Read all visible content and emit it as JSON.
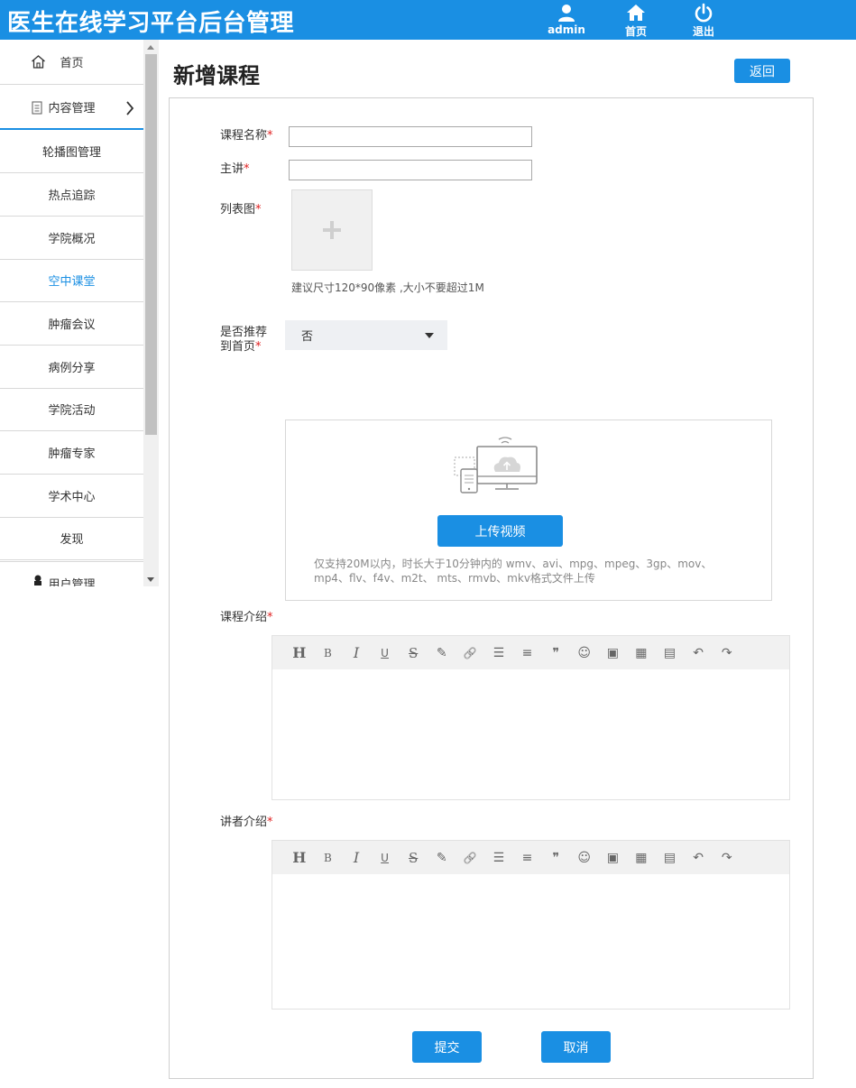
{
  "app": {
    "title": "医生在线学习平台后台管理"
  },
  "header": {
    "user_label": "admin",
    "home_label": "首页",
    "logout_label": "退出"
  },
  "sidebar": {
    "home": "首页",
    "content_group": "内容管理",
    "items": [
      {
        "label": "轮播图管理"
      },
      {
        "label": "热点追踪"
      },
      {
        "label": "学院概况"
      },
      {
        "label": "空中课堂",
        "active": true
      },
      {
        "label": "肿瘤会议"
      },
      {
        "label": "病例分享"
      },
      {
        "label": "学院活动"
      },
      {
        "label": "肿瘤专家"
      },
      {
        "label": "学术中心"
      },
      {
        "label": "发现"
      }
    ],
    "user_group": "用户管理"
  },
  "page": {
    "title": "新增课程",
    "back_label": "返回"
  },
  "form": {
    "required_mark": "*",
    "course_name_label": "课程名称",
    "course_name_value": "",
    "lecturer_label": "主讲",
    "lecturer_value": "",
    "list_image_label": "列表图",
    "list_image_hint": "建议尺寸120*90像素 ,大小不要超过1M",
    "recommend_label_line1": "是否推荐",
    "recommend_label_line2": "到首页",
    "recommend_value": "否",
    "upload_video_label": "上传视频",
    "video_hint": "仅支持20M以内，时长大于10分钟内的 wmv、avi、mpg、mpeg、3gp、mov、mp4、flv、f4v、m2t、 mts、rmvb、mkv格式文件上传",
    "course_intro_label": "课程介绍",
    "lecturer_intro_label": "讲者介绍",
    "submit_label": "提交",
    "cancel_label": "取消"
  },
  "editor_toolbar": [
    {
      "name": "heading-icon",
      "glyph": "H"
    },
    {
      "name": "bold-icon",
      "glyph": "B"
    },
    {
      "name": "italic-icon",
      "glyph": "I"
    },
    {
      "name": "underline-icon",
      "glyph": "U"
    },
    {
      "name": "strikethrough-icon",
      "glyph": "S"
    },
    {
      "name": "pen-icon",
      "glyph": "✎"
    },
    {
      "name": "link-icon",
      "glyph": "🔗"
    },
    {
      "name": "list-icon",
      "glyph": "☰"
    },
    {
      "name": "align-icon",
      "glyph": "≡"
    },
    {
      "name": "quote-icon",
      "glyph": "❞"
    },
    {
      "name": "emoji-icon",
      "glyph": "☺"
    },
    {
      "name": "image-icon",
      "glyph": "▣"
    },
    {
      "name": "table-icon",
      "glyph": "▦"
    },
    {
      "name": "video-icon",
      "glyph": "▤"
    },
    {
      "name": "undo-icon",
      "glyph": "↶"
    },
    {
      "name": "redo-icon",
      "glyph": "↷"
    }
  ],
  "colors": {
    "primary": "#1a8fe3",
    "required": "#e02020"
  }
}
